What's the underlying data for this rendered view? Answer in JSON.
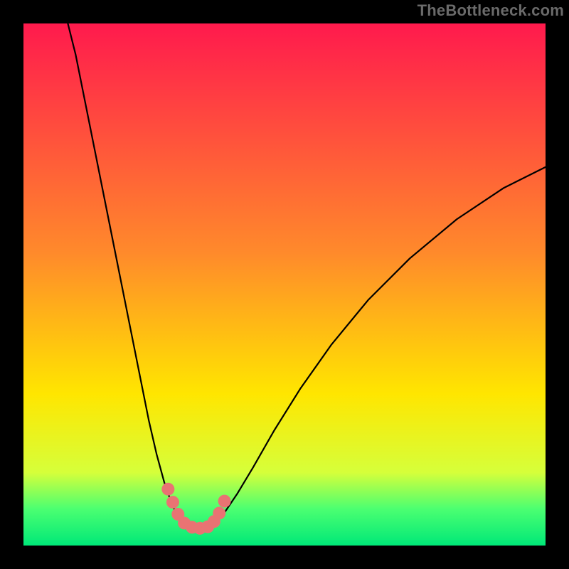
{
  "watermark": "TheBottleneck.com",
  "colors": {
    "top": "#ff1a4d",
    "upper_mid": "#ff8a2b",
    "mid": "#ffe600",
    "lower_mid": "#d6ff3a",
    "green_band_light": "#4bff71",
    "green_bottom": "#00e878",
    "curve": "#000000",
    "marker_fill": "#e97373",
    "frame": "#000000"
  },
  "chart_data": {
    "type": "line",
    "title": "",
    "xlabel": "",
    "ylabel": "",
    "xlim": [
      0,
      100
    ],
    "ylim": [
      0,
      100
    ],
    "series": [
      {
        "name": "left-branch",
        "x": [
          8.5,
          10,
          12,
          14,
          16,
          18,
          20,
          22,
          24,
          25.5,
          27,
          28.3,
          29.2,
          30.2
        ],
        "y": [
          100,
          94,
          84,
          74,
          64,
          54,
          44,
          34,
          24,
          17.5,
          12,
          8.3,
          6.2,
          4.6
        ]
      },
      {
        "name": "valley-floor",
        "x": [
          30.2,
          31.5,
          33,
          34.5,
          35.8,
          36.7
        ],
        "y": [
          4.6,
          3.6,
          3.1,
          3.1,
          3.5,
          4.2
        ]
      },
      {
        "name": "right-branch",
        "x": [
          36.7,
          38.5,
          41,
          44,
          48,
          53,
          59,
          66,
          74,
          83,
          92,
          100
        ],
        "y": [
          4.2,
          6.3,
          10,
          15,
          22,
          30,
          38.5,
          47,
          55,
          62.5,
          68.5,
          72.5
        ]
      }
    ],
    "markers": [
      {
        "series": "left-markers",
        "x": 27.7,
        "y": 10.8
      },
      {
        "series": "left-markers",
        "x": 28.6,
        "y": 8.3
      },
      {
        "series": "left-markers",
        "x": 29.6,
        "y": 6.0
      },
      {
        "series": "floor-markers",
        "x": 30.8,
        "y": 4.3
      },
      {
        "series": "floor-markers",
        "x": 32.3,
        "y": 3.5
      },
      {
        "series": "floor-markers",
        "x": 33.8,
        "y": 3.3
      },
      {
        "series": "floor-markers",
        "x": 35.3,
        "y": 3.6
      },
      {
        "series": "right-markers",
        "x": 36.5,
        "y": 4.6
      },
      {
        "series": "right-markers",
        "x": 37.5,
        "y": 6.2
      },
      {
        "series": "right-markers",
        "x": 38.5,
        "y": 8.5
      }
    ],
    "gradient_bands_pct": [
      {
        "at": 0,
        "color": "top"
      },
      {
        "at": 44,
        "color": "upper_mid"
      },
      {
        "at": 71,
        "color": "mid"
      },
      {
        "at": 86,
        "color": "lower_mid"
      },
      {
        "at": 93,
        "color": "green_band_light"
      },
      {
        "at": 100,
        "color": "green_bottom"
      }
    ]
  }
}
